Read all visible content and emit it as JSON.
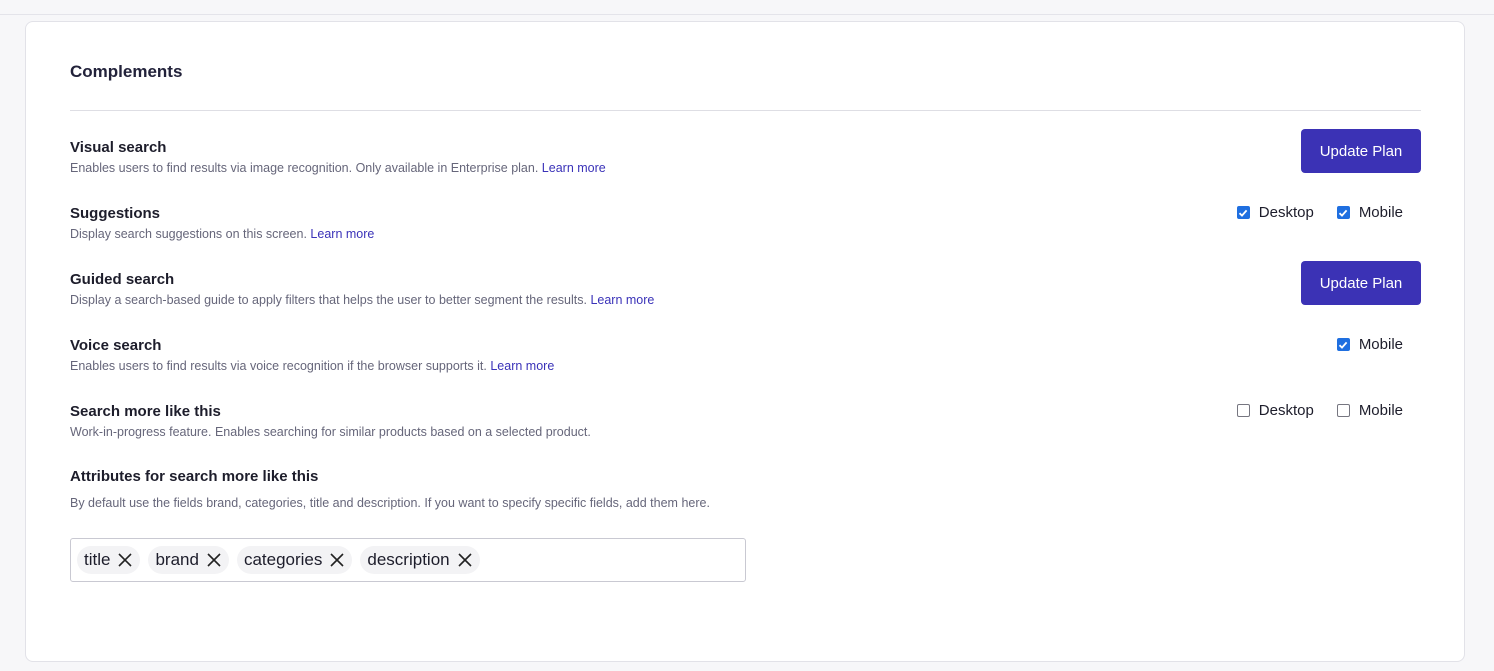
{
  "section_title": "Complements",
  "learn_more": "Learn more",
  "rows": [
    {
      "title": "Visual search",
      "description": "Enables users to find results via image recognition. Only available in Enterprise plan.",
      "action": "Update Plan"
    },
    {
      "title": "Suggestions",
      "description": "Display search suggestions on this screen.",
      "checkboxes": [
        {
          "label": "Desktop",
          "checked": true
        },
        {
          "label": "Mobile",
          "checked": true
        }
      ]
    },
    {
      "title": "Guided search",
      "description": "Display a search-based guide to apply filters that helps the user to better segment the results.",
      "action": "Update Plan"
    },
    {
      "title": "Voice search",
      "description": "Enables users to find results via voice recognition if the browser supports it.",
      "checkboxes": [
        {
          "label": "Mobile",
          "checked": true
        }
      ]
    },
    {
      "title": "Search more like this",
      "description": "Work-in-progress feature. Enables searching for similar products based on a selected product.",
      "checkboxes": [
        {
          "label": "Desktop",
          "checked": false
        },
        {
          "label": "Mobile",
          "checked": false
        }
      ]
    }
  ],
  "attributes": {
    "title": "Attributes for search more like this",
    "description": "By default use the fields brand, categories, title and description. If you want to specify specific fields, add them here.",
    "tags": [
      "title",
      "brand",
      "categories",
      "description"
    ]
  },
  "colors": {
    "accent": "#3b32b5",
    "link": "#3a32b8",
    "checkbox_checked": "#1f6fe0"
  }
}
